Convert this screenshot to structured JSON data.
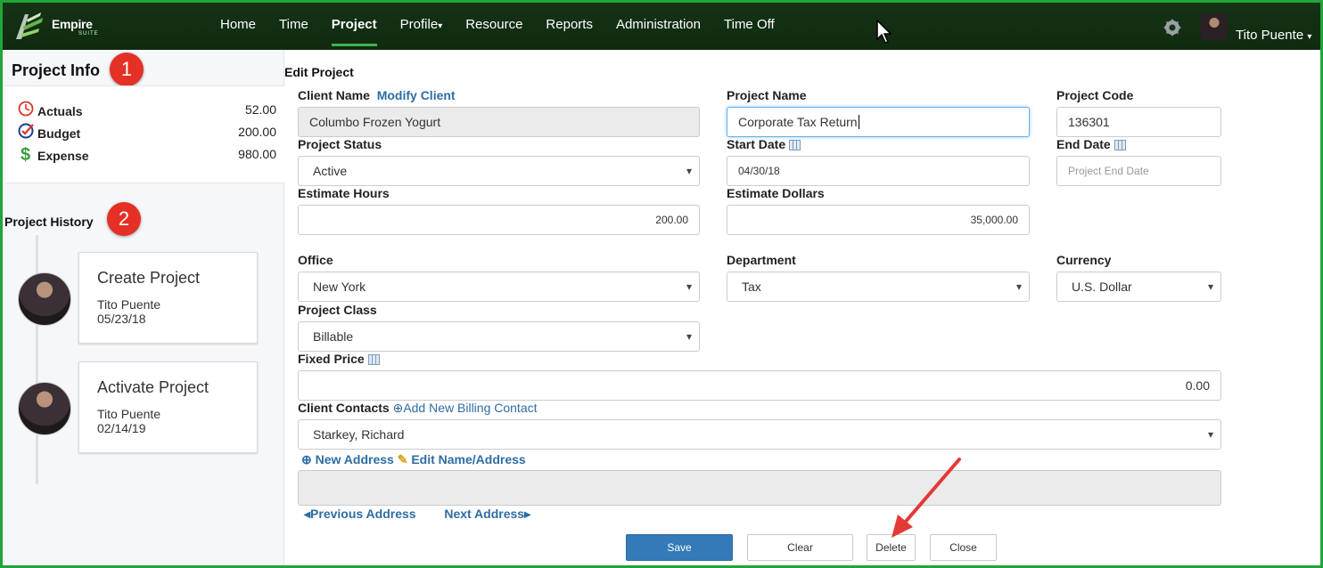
{
  "app": {
    "brand": "Empire",
    "brand_sub": "SUITE"
  },
  "nav": {
    "items": [
      {
        "label": "Home"
      },
      {
        "label": "Time"
      },
      {
        "label": "Project",
        "active": true
      },
      {
        "label": "Profile",
        "has_caret": true
      },
      {
        "label": "Resource"
      },
      {
        "label": "Reports"
      },
      {
        "label": "Administration"
      },
      {
        "label": "Time Off"
      }
    ],
    "user_name": "Tito Puente",
    "caret": "▾"
  },
  "sidebar": {
    "project_info_title": "Project Info",
    "badge1": "1",
    "info": [
      {
        "label": "Actuals",
        "value": "52.00",
        "icon": "clock-icon"
      },
      {
        "label": "Budget",
        "value": "200.00",
        "icon": "checkmark-icon"
      },
      {
        "label": "Expense",
        "value": "980.00",
        "icon": "dollar-icon"
      }
    ],
    "history_title": "Project History",
    "badge2": "2",
    "history": [
      {
        "title": "Create Project",
        "user": "Tito Puente",
        "date": "05/23/18"
      },
      {
        "title": "Activate Project",
        "user": "Tito Puente",
        "date": "02/14/19"
      }
    ]
  },
  "form": {
    "title": "Edit Project",
    "client_name_label": "Client Name",
    "modify_client_link": "Modify Client",
    "client_name_value": "Columbo Frozen Yogurt",
    "project_name_label": "Project Name",
    "project_name_value": "Corporate Tax Return",
    "project_code_label": "Project Code",
    "project_code_value": "136301",
    "project_status_label": "Project Status",
    "project_status_value": "Active",
    "start_date_label": "Start Date",
    "start_date_value": "04/30/18",
    "end_date_label": "End Date",
    "end_date_placeholder": "Project End Date",
    "estimate_hours_label": "Estimate Hours",
    "estimate_hours_value": "200.00",
    "estimate_dollars_label": "Estimate Dollars",
    "estimate_dollars_value": "35,000.00",
    "office_label": "Office",
    "office_value": "New York",
    "department_label": "Department",
    "department_value": "Tax",
    "currency_label": "Currency",
    "currency_value": "U.S. Dollar",
    "project_class_label": "Project Class",
    "project_class_value": "Billable",
    "fixed_price_label": "Fixed Price",
    "fixed_price_value": "0.00",
    "client_contacts_label": "Client Contacts",
    "add_billing_contact_link": "Add New Billing Contact",
    "client_contact_value": "Starkey, Richard",
    "new_address_link": "New Address",
    "edit_name_address_link": "Edit Name/Address",
    "previous_address_link": "Previous Address",
    "next_address_link": "Next Address"
  },
  "buttons": {
    "save": "Save",
    "clear": "Clear",
    "delete": "Delete",
    "close": "Close"
  },
  "colors": {
    "nav_bg": "#163316",
    "accent": "#3cb34a",
    "frame": "#22a43a",
    "badge": "#e53025",
    "link": "#2e6da4",
    "primary": "#337ab7",
    "arrow": "#e53935"
  }
}
